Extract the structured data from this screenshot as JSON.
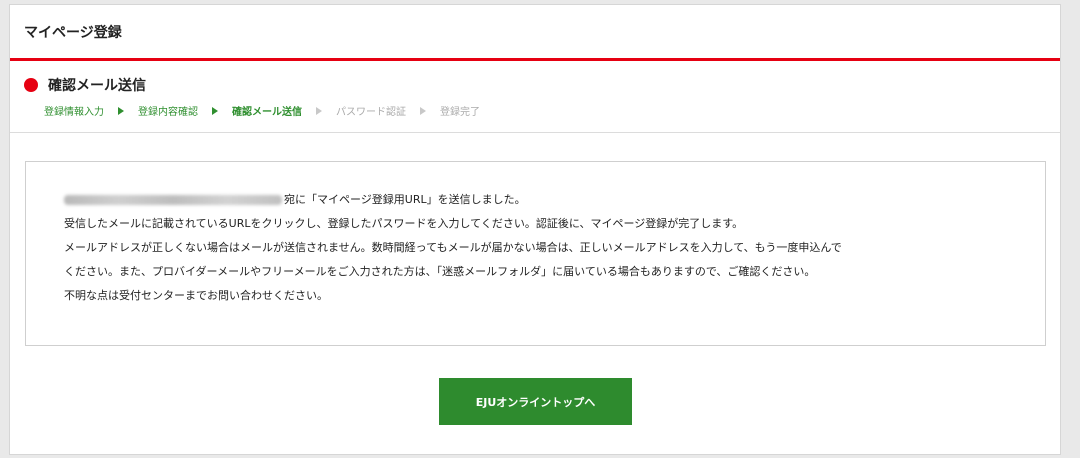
{
  "header": {
    "title": "マイページ登録"
  },
  "section": {
    "title": "確認メール送信"
  },
  "steps": [
    {
      "label": "登録情報入力",
      "state": "done"
    },
    {
      "label": "登録内容確認",
      "state": "done"
    },
    {
      "label": "確認メール送信",
      "state": "current"
    },
    {
      "label": "パスワード認証",
      "state": "pending"
    },
    {
      "label": "登録完了",
      "state": "pending"
    }
  ],
  "message": {
    "email_suffix": "宛に「マイページ登録用URL」を送信しました。",
    "line2": "受信したメールに記載されているURLをクリックし、登録したパスワードを入力してください。認証後に、マイページ登録が完了します。",
    "line3": "メールアドレスが正しくない場合はメールが送信されません。数時間経ってもメールが届かない場合は、正しいメールアドレスを入力して、もう一度申込んで",
    "line4": "ください。また、プロバイダーメールやフリーメールをご入力された方は、「迷惑メールフォルダ」に届いている場合もありますので、ご確認ください。",
    "line5": "不明な点は受付センターまでお問い合わせください。"
  },
  "cta": {
    "label": "EJUオンライントップへ"
  },
  "colors": {
    "accent_red": "#e60012",
    "brand_green": "#2e8b2e",
    "pending_gray": "#aaaaaa"
  }
}
